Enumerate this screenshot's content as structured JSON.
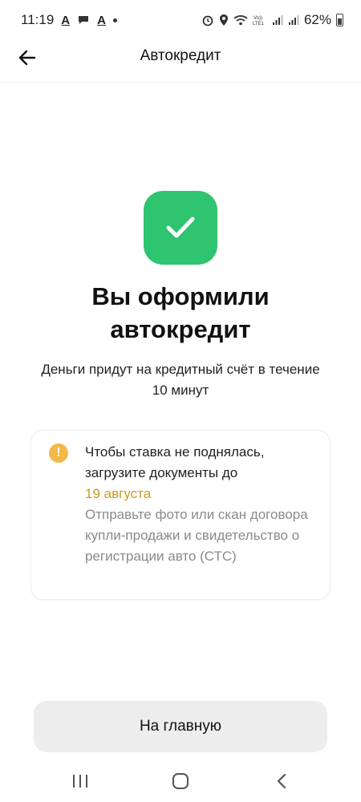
{
  "status_bar": {
    "time": "11:19",
    "battery": "62%",
    "left_icons": [
      "app-a-icon",
      "chat-icon",
      "app-a-icon",
      "dot-icon"
    ],
    "right_icons": [
      "alarm-icon",
      "location-icon",
      "wifi-icon",
      "volte-icon",
      "signal-icon",
      "signal-icon",
      "battery-icon"
    ],
    "volte_label": "Vo))\nLTE1"
  },
  "header": {
    "title": "Автокредит",
    "back_icon": "arrow-left-icon"
  },
  "success": {
    "icon": "checkmark-icon",
    "icon_color": "#2fc46f",
    "title": "Вы оформили автокредит",
    "subtitle": "Деньги придут на кредитный счёт в течение 10 минут"
  },
  "notice": {
    "icon": "warning-icon",
    "icon_glyph": "!",
    "icon_color": "#f2b94a",
    "main_text": "Чтобы ставка не поднялась, загрузите документы до",
    "date_text": "19 августа",
    "date_color": "#d19a1f",
    "hint_text": "Отправьте фото или скан договора купли-продажи и свидетельство о регистрации авто (СТС)"
  },
  "actions": {
    "home_label": "На главную"
  },
  "navbar": {
    "items": [
      "recent-apps-icon",
      "home-icon",
      "back-icon"
    ]
  }
}
